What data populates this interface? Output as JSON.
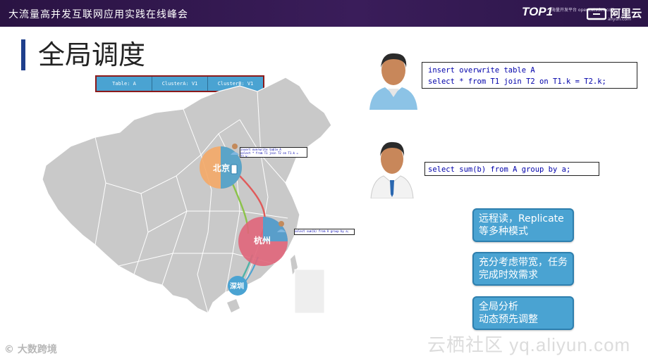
{
  "header": {
    "event_title": "大流量高并发互联网应用实践在线峰会",
    "logo_top100": "TOP1",
    "logo_top100_sub": "海量开发平台 opencatsdev.com",
    "logo_aliyun": "阿里云",
    "logo_aliyun_sub": "aliyun.com"
  },
  "page": {
    "title": "全局调度"
  },
  "table_bar": {
    "cells": [
      "Table: A",
      "ClusterA: V1",
      "ClusterB: V1"
    ]
  },
  "map": {
    "cities": [
      "北京",
      "杭州",
      "深圳"
    ]
  },
  "code": {
    "query1_line1": "insert overwrite table A",
    "query1_line2": "select * from T1 join T2 on T1.k = T2.k;",
    "query2": "select sum(b) from A group by a;",
    "mini1_line1": "insert overwrite table A",
    "mini1_line2": "select * from T1 join T2 on T1.k = T2.k;",
    "mini2": "select sum(b) from A group by a;"
  },
  "features": {
    "item1": "远程读，Replicate等多种模式",
    "item2": "充分考虑带宽，任务完成时效需求",
    "item3_line1": "全局分析",
    "item3_line2": "动态预先调整"
  },
  "watermark": "云栖社区 yq.aliyun.com",
  "brand": "大数跨境",
  "colors": {
    "header_bg": "#2a1343",
    "title_accent": "#1f3f8c",
    "feature_box": "#4aa3d2",
    "beijing_circle": "#f4a867",
    "hangzhou_circle": "#e0657a",
    "shenzhen_circle": "#4aa3d2"
  }
}
